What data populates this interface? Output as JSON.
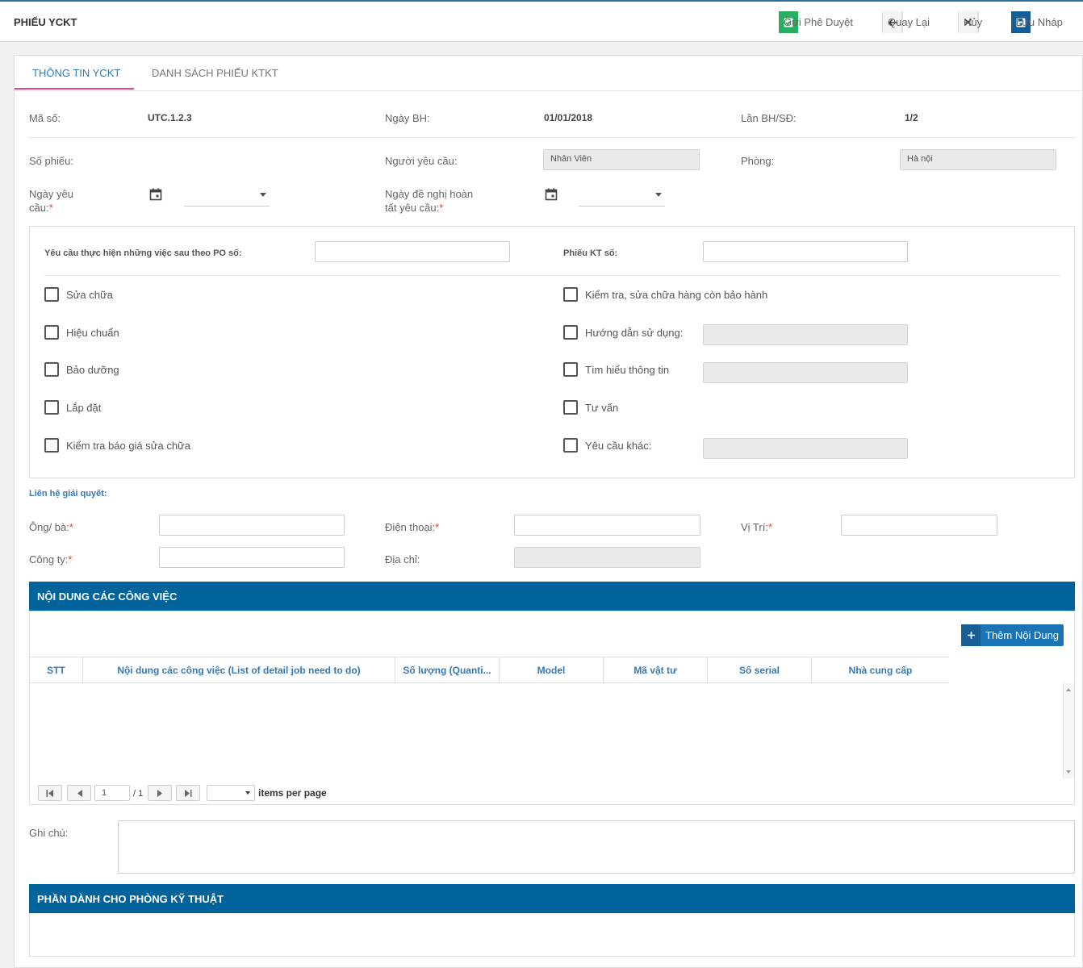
{
  "header": {
    "title": "PHIẾU YCKT",
    "buttons": {
      "send": "Gửi Phê Duyệt",
      "back": "Quay Lại",
      "cancel": "Hủy",
      "save": "Lưu Nháp"
    }
  },
  "tabs": [
    {
      "label": "THÔNG TIN YCKT",
      "active": true
    },
    {
      "label": "DANH SÁCH PHIẾU KTKT",
      "active": false
    }
  ],
  "info": {
    "ma_so_label": "Mã số:",
    "ma_so_value": "UTC.1.2.3",
    "ngay_bh_label": "Ngày BH:",
    "ngay_bh_value": "01/01/2018",
    "lan_bh_label": "Lần BH/SĐ:",
    "lan_bh_value": "1/2",
    "so_phieu_label": "Số phiếu:",
    "nguoi_yc_label": "Người yêu cầu:",
    "nguoi_yc_value": "Nhân Viên",
    "phong_label": "Phòng:",
    "phong_value": "Hà nội",
    "ngay_yc_label_1": "Ngày yêu",
    "ngay_yc_label_2": "cầu:",
    "ngay_hoan_label_1": "Ngày đề nghị hoàn",
    "ngay_hoan_label_2": "tất yêu cầu:",
    "required_mark": "*"
  },
  "request_panel": {
    "po_label": "Yêu cầu thực hiện những việc sau theo PO số:",
    "kt_label": "Phiếu KT số:",
    "left_checks": [
      "Sửa chữa",
      "Hiệu chuẩn",
      "Bảo dưỡng",
      "Lắp đặt",
      "Kiểm tra báo giá sửa chữa"
    ],
    "right_checks": [
      "Kiểm tra, sửa chữa hàng còn bảo hành",
      "Hướng dẫn sử dụng:",
      "Tìm hiểu thông tin",
      "Tư vấn",
      "Yêu cầu khác:"
    ]
  },
  "contact": {
    "section_title": "Liên hệ giải quyết:",
    "ong_ba": "Ông/ bà:",
    "dien_thoai": "Điện thoại:",
    "vi_tri": "Vị Trí:",
    "cong_ty": "Công ty:",
    "dia_chi": "Địa chỉ:"
  },
  "jobs": {
    "title": "NỘI DUNG CÁC CÔNG VIỆC",
    "add_button": "Thêm Nội Dung",
    "columns": [
      "STT",
      "Nội dung các công việc (List of detail job need to do)",
      "Số lượng (Quanti...",
      "Model",
      "Mã vật tư",
      "Số serial",
      "Nhà cung cấp"
    ],
    "pager": {
      "page": "1",
      "total": "/ 1",
      "per_page_label": "items per page"
    }
  },
  "notes": {
    "label": "Ghi chú:"
  },
  "tech": {
    "title": "PHẦN DÀNH CHO PHÒNG KỸ THUẬT"
  }
}
